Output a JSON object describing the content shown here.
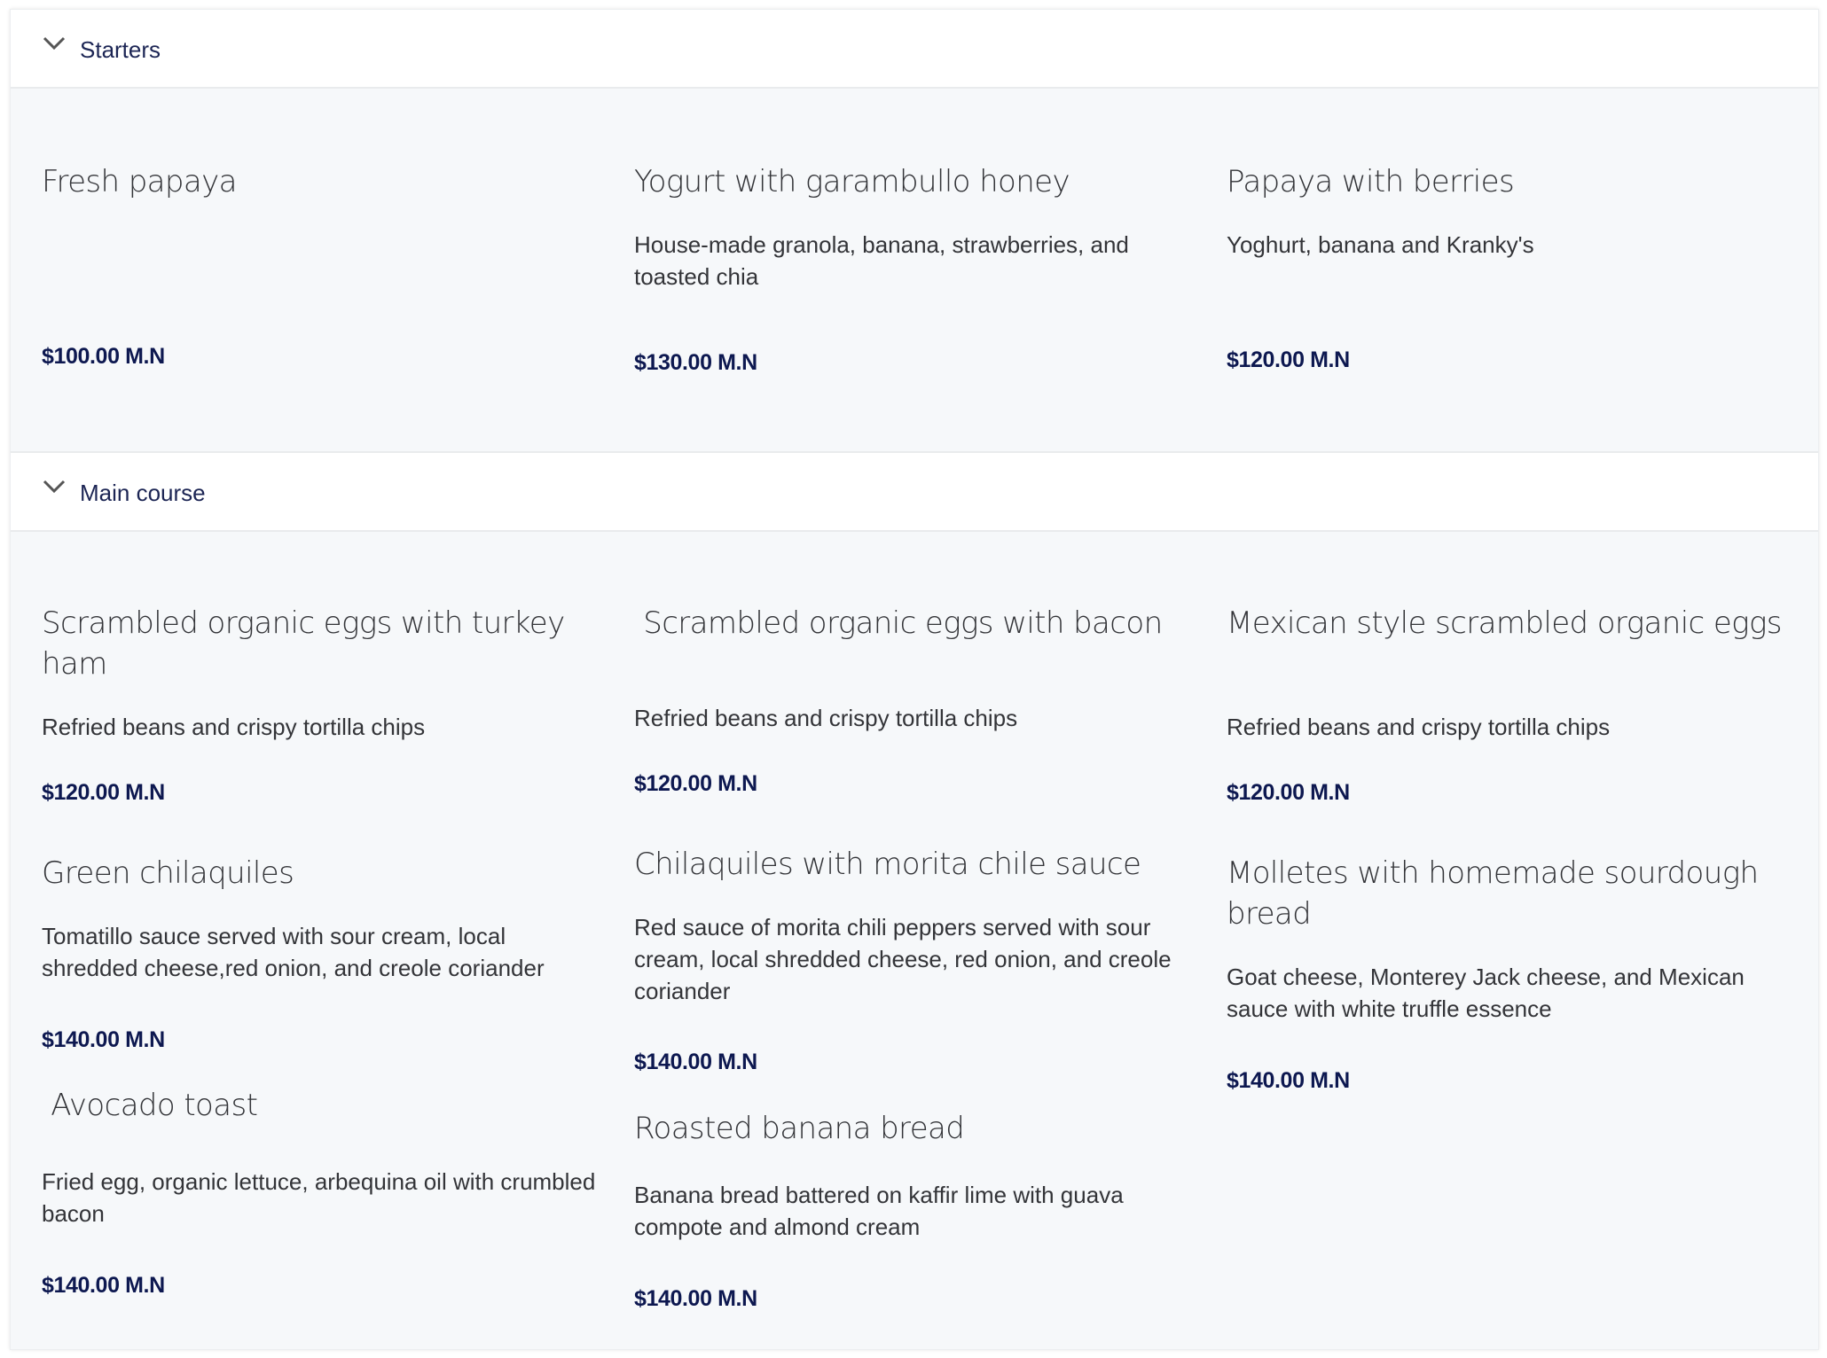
{
  "sections": [
    {
      "label": "Starters",
      "expanded": true,
      "icon": "chevron-down-icon",
      "items": [
        {
          "title": "Fresh papaya",
          "description": "",
          "price": "$100.00 M.N"
        },
        {
          "title": "Yogurt with garambullo honey",
          "description": "House-made granola, banana, strawberries, and toasted chia",
          "price": "$130.00 M.N"
        },
        {
          "title": "Papaya with berries",
          "description": "Yoghurt, banana and Kranky's",
          "price": "$120.00 M.N"
        }
      ]
    },
    {
      "label": "Main course",
      "expanded": true,
      "icon": "chevron-down-icon",
      "items": [
        {
          "title": "Scrambled organic eggs with turkey ham",
          "description": "Refried beans and crispy tortilla chips",
          "price": "$120.00 M.N"
        },
        {
          "title": " Scrambled organic eggs with bacon",
          "description": "Refried beans and crispy tortilla chips",
          "price": "$120.00 M.N"
        },
        {
          "title": "Mexican style scrambled organic eggs",
          "description": "Refried beans and crispy tortilla chips",
          "price": "$120.00 M.N"
        },
        {
          "title": "Green chilaquiles",
          "description": "Tomatillo sauce served with sour cream, local shredded cheese,red onion, and creole coriander",
          "price": "$140.00 M.N"
        },
        {
          "title": "Chilaquiles with morita chile sauce",
          "description": "Red sauce of morita chili peppers served with sour cream, local shredded cheese, red onion, and creole coriander",
          "price": "$140.00 M.N"
        },
        {
          "title": "Molletes with homemade sourdough bread",
          "description": "Goat cheese, Monterey Jack cheese, and Mexican sauce with white truffle essence",
          "price": "$140.00 M.N"
        },
        {
          "title": " Avocado toast",
          "description": "Fried egg, organic lettuce, arbequina oil with crumbled bacon",
          "price": "$140.00 M.N"
        },
        {
          "title": "Roasted banana bread",
          "description": "Banana bread battered on kaffir lime with guava compote and almond cream",
          "price": "$140.00 M.N"
        }
      ]
    }
  ],
  "colors": {
    "section_label": "#1c2554",
    "price": "#0d1850",
    "body_text": "#333438",
    "content_bg": "#f6f8fa"
  }
}
